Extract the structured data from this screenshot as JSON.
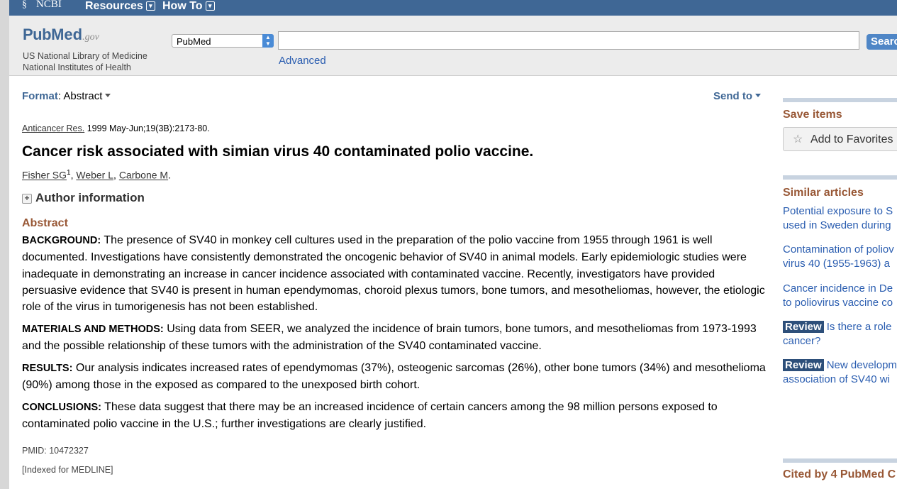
{
  "ncbi": {
    "logo": "NCBI",
    "resources": "Resources",
    "howto": "How To"
  },
  "header": {
    "logo_pub": "Pub",
    "logo_med": "Med",
    "logo_gov": ".gov",
    "tagline": "US National Library of Medicine National Institutes of Health",
    "db_selected": "PubMed",
    "search_value": "",
    "search_button": "Search",
    "advanced": "Advanced"
  },
  "toolbar": {
    "format_label": "Format",
    "format_value": "Abstract",
    "send_to": "Send to"
  },
  "article": {
    "journal": "Anticancer Res.",
    "citation_rest": " 1999 May-Jun;19(3B):2173-80.",
    "title": "Cancer risk associated with simian virus 40 contaminated polio vaccine.",
    "authors": [
      {
        "name": "Fisher SG",
        "sup": "1"
      },
      {
        "name": "Weber L"
      },
      {
        "name": "Carbone M"
      }
    ],
    "author_info": "Author information",
    "abstract_heading": "Abstract",
    "sections": [
      {
        "label": "BACKGROUND:",
        "text": " The presence of SV40 in monkey cell cultures used in the preparation of the polio vaccine from 1955 through 1961 is well documented. Investigations have consistently demonstrated the oncogenic behavior of SV40 in animal models. Early epidemiologic studies were inadequate in demonstrating an increase in cancer incidence associated with contaminated vaccine. Recently, investigators have provided persuasive evidence that SV40 is present in human ependymomas, choroid plexus tumors, bone tumors, and mesotheliomas, however, the etiologic role of the virus in tumorigenesis has not been established."
      },
      {
        "label": "MATERIALS AND METHODS:",
        "text": " Using data from SEER, we analyzed the incidence of brain tumors, bone tumors, and mesotheliomas from 1973-1993 and the possible relationship of these tumors with the administration of the SV40 contaminated vaccine."
      },
      {
        "label": "RESULTS:",
        "text": " Our analysis indicates increased rates of ependymomas (37%), osteogenic sarcomas (26%), other bone tumors (34%) and mesothelioma (90%) among those in the exposed as compared to the unexposed birth cohort."
      },
      {
        "label": "CONCLUSIONS:",
        "text": " These data suggest that there may be an increased incidence of certain cancers among the 98 million persons exposed to contaminated polio vaccine in the U.S.; further investigations are clearly justified."
      }
    ],
    "pmid": "PMID: 10472327",
    "indexed": "[Indexed for MEDLINE]"
  },
  "sidebar": {
    "save_heading": "Save items",
    "add_favorites": "Add to Favorites",
    "similar_heading": "Similar articles",
    "similar": [
      {
        "line1": "Potential exposure to S",
        "line2": "used in Sweden during"
      },
      {
        "line1": "Contamination of poliov",
        "line2": "virus 40 (1955-1963) a"
      },
      {
        "line1": "Cancer incidence in De",
        "line2": "to poliovirus vaccine co"
      },
      {
        "badge": "Review",
        "line1": "Is there a role",
        "line2": "cancer?"
      },
      {
        "badge": "Review",
        "line1": "New developm",
        "line2": "association of SV40 wi"
      }
    ],
    "cited_heading": "Cited by 4 PubMed C"
  },
  "colors": {
    "ncbi_bar": "#3f6795",
    "heading_brown": "#985735",
    "link_blue": "#2a5db0",
    "review_badge": "#2d4f7a"
  }
}
